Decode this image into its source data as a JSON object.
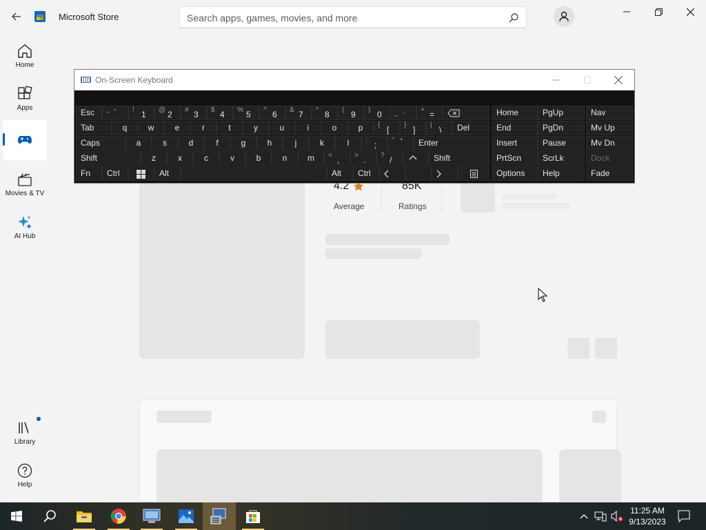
{
  "titlebar": {
    "app_title": "Microsoft Store",
    "search_placeholder": "Search apps, games, movies, and more"
  },
  "sidebar": {
    "items": [
      {
        "label": "Home",
        "icon": "home-icon"
      },
      {
        "label": "Apps",
        "icon": "apps-icon"
      },
      {
        "label": "",
        "icon": "gaming-icon",
        "active": true
      },
      {
        "label": "Movies & TV",
        "icon": "movies-icon"
      },
      {
        "label": "AI Hub",
        "icon": "ai-hub-icon"
      },
      {
        "label": "Library",
        "icon": "library-icon",
        "badge": true
      },
      {
        "label": "Help",
        "icon": "help-icon"
      }
    ]
  },
  "product": {
    "rating": "4.2",
    "rating_label": "Average",
    "ratings_count": "85K",
    "ratings_label": "Ratings"
  },
  "osk": {
    "title": "On-Screen Keyboard",
    "keys": {
      "esc": "Esc",
      "tilde_s": "~",
      "tilde_m": "`",
      "n1_s": "!",
      "n1": "1",
      "n2_s": "@",
      "n2": "2",
      "n3_s": "#",
      "n3": "3",
      "n4_s": "$",
      "n4": "4",
      "n5_s": "%",
      "n5": "5",
      "n6_s": "^",
      "n6": "6",
      "n7_s": "&",
      "n7": "7",
      "n8_s": "*",
      "n8": "8",
      "n9_s": "(",
      "n9": "9",
      "n0_s": ")",
      "n0": "0",
      "minus_s": "_",
      "minus": "-",
      "eq_s": "+",
      "eq": "=",
      "tab": "Tab",
      "q": "q",
      "w": "w",
      "e": "e",
      "r": "r",
      "t": "t",
      "y": "y",
      "u": "u",
      "i": "i",
      "o": "o",
      "p": "p",
      "lbr_s": "{",
      "lbr": "[",
      "rbr_s": "}",
      "rbr": "]",
      "bsl_s": "|",
      "bsl": "\\",
      "del": "Del",
      "caps": "Caps",
      "a": "a",
      "s": "s",
      "d": "d",
      "f": "f",
      "g": "g",
      "h": "h",
      "j": "j",
      "k": "k",
      "l": "l",
      "semi_s": ":",
      "semi": ";",
      "quote_s": "\"",
      "quote": "'",
      "enter": "Enter",
      "shift": "Shift",
      "z": "z",
      "x": "x",
      "c": "c",
      "v": "v",
      "b": "b",
      "n": "n",
      "m": "m",
      "comma_s": "<",
      "comma": ",",
      "dot_s": ">",
      "dot": ".",
      "slash_s": "?",
      "slash": "/",
      "shift_r": "Shift",
      "fn": "Fn",
      "ctrl": "Ctrl",
      "alt": "Alt",
      "alt_r": "Alt",
      "ctrl_r": "Ctrl",
      "home": "Home",
      "pgup": "PgUp",
      "nav": "Nav",
      "end": "End",
      "pgdn": "PgDn",
      "mvup": "Mv Up",
      "insert": "Insert",
      "pause": "Pause",
      "mvdn": "Mv Dn",
      "prtscn": "PrtScn",
      "scrlk": "ScrLk",
      "dock": "Dock",
      "options": "Options",
      "help": "Help",
      "fade": "Fade"
    }
  },
  "taskbar": {
    "time": "11:25 AM",
    "date": "9/13/2023",
    "apps": [
      "start-icon",
      "search-icon",
      "file-explorer-icon",
      "chrome-icon",
      "remote-desktop-icon",
      "photos-icon",
      "osk-app-icon",
      "store-icon"
    ]
  },
  "colors": {
    "accent": "#005fb8",
    "star": "#e37d1b",
    "osk_bg": "#111111",
    "osk_key": "#222222"
  }
}
